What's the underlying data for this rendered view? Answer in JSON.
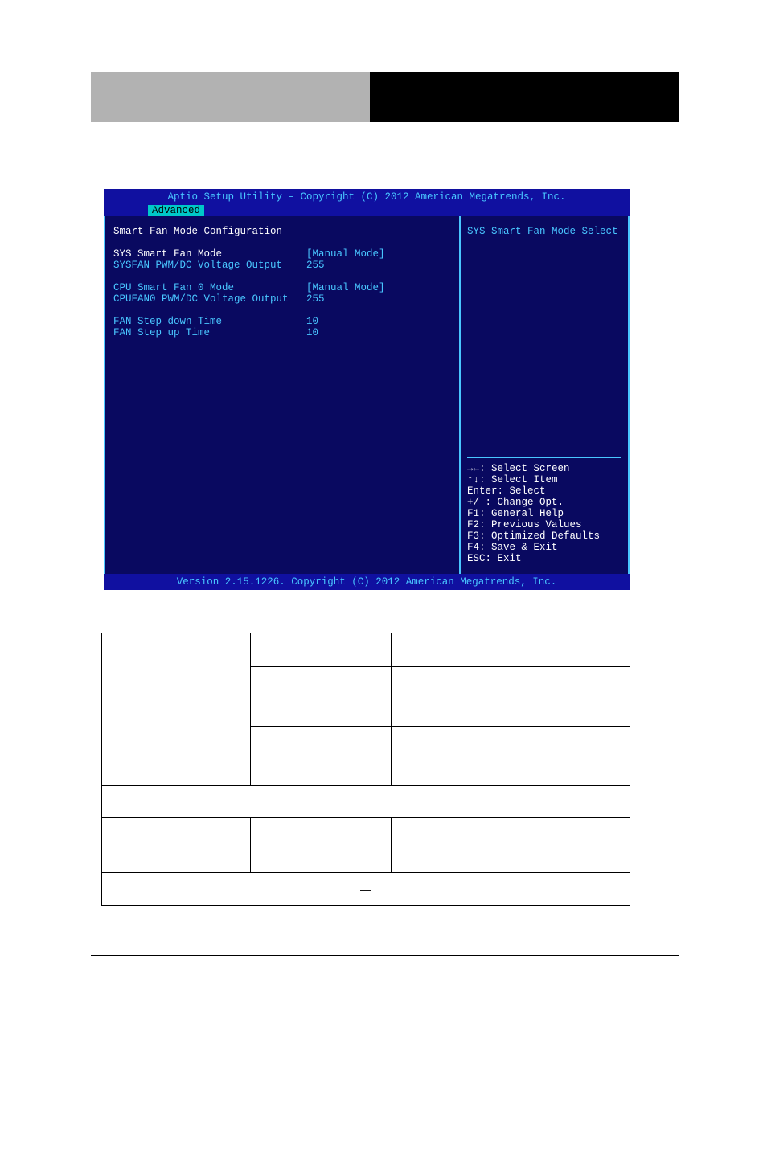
{
  "bios": {
    "header": "Aptio Setup Utility – Copyright (C) 2012 American Megatrends, Inc.",
    "tab": "Advanced",
    "section_title": "Smart Fan Mode Configuration",
    "rows": [
      {
        "label": "SYS Smart Fan Mode",
        "value": "[Manual Mode]"
      },
      {
        "label": "SYSFAN PWM/DC Voltage Output",
        "value": "255"
      },
      {
        "label": "CPU Smart Fan 0 Mode",
        "value": "[Manual Mode]"
      },
      {
        "label": "CPUFAN0 PWM/DC Voltage Output",
        "value": "255"
      },
      {
        "label": "FAN Step down Time",
        "value": "10"
      },
      {
        "label": "FAN Step up Time",
        "value": "10"
      }
    ],
    "help_title": "SYS Smart Fan Mode Select",
    "keys": [
      "→←: Select Screen",
      "↑↓: Select Item",
      "Enter: Select",
      "+/-: Change Opt.",
      "F1: General Help",
      "F2: Previous Values",
      "F3: Optimized Defaults",
      "F4: Save & Exit",
      "ESC: Exit"
    ],
    "footer": "Version 2.15.1226. Copyright (C) 2012 American Megatrends, Inc."
  },
  "table": {
    "r1c1": "",
    "r1c2": "",
    "r1c3": "",
    "r2c2": "",
    "r2c3": "",
    "r3c2": "",
    "r3c3": "",
    "full1": "",
    "r4c1": "",
    "r4c2": "",
    "r4c3": "",
    "continued": "—"
  }
}
